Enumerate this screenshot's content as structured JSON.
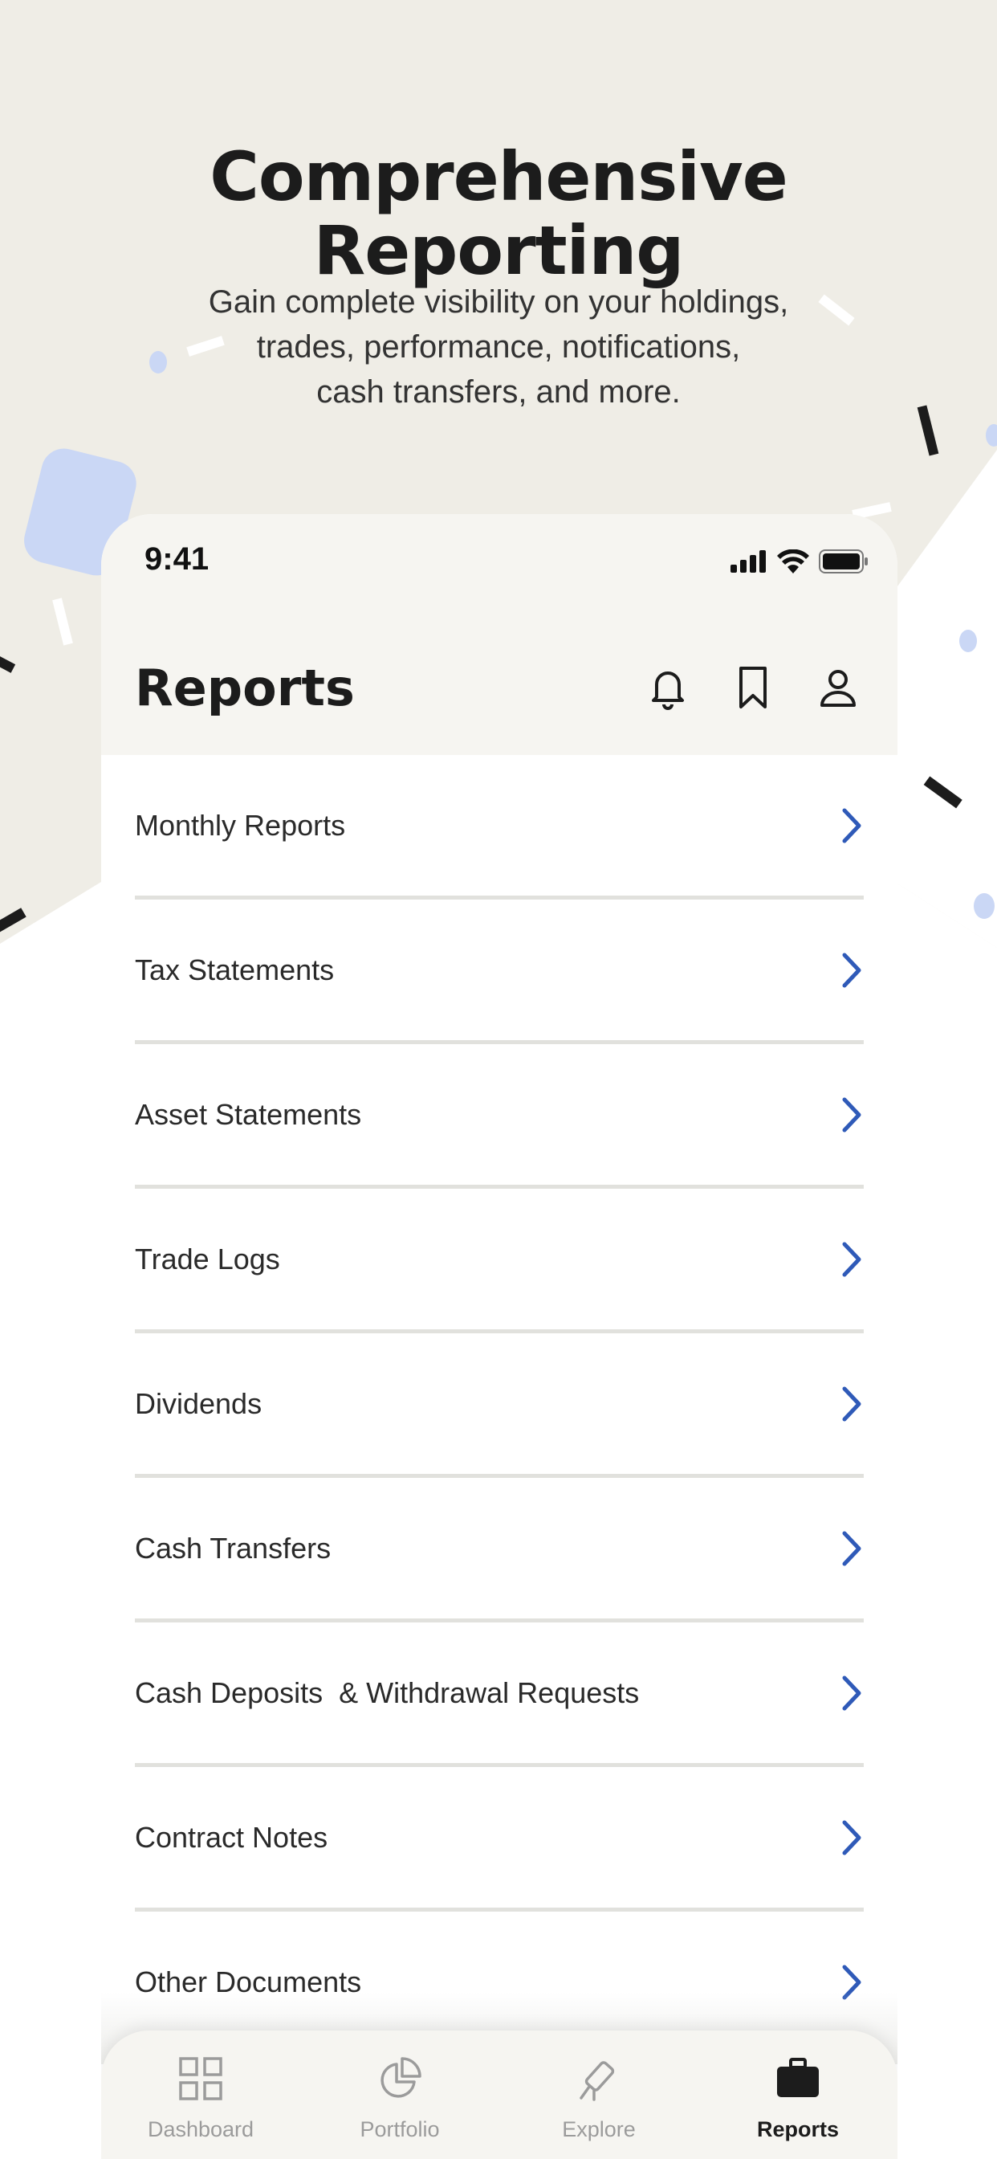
{
  "hero": {
    "title_line1": "Comprehensive",
    "title_line2": "Reporting",
    "subtitle_line1": "Gain complete visibility on your holdings,",
    "subtitle_line2": "trades, performance, notifications,",
    "subtitle_line3": "cash transfers, and more."
  },
  "status_bar": {
    "time": "9:41"
  },
  "header": {
    "title": "Reports",
    "icons": [
      "bell-icon",
      "bookmark-icon",
      "profile-icon"
    ]
  },
  "reports": [
    {
      "label": "Monthly Reports"
    },
    {
      "label": "Tax Statements"
    },
    {
      "label": "Asset Statements"
    },
    {
      "label": "Trade Logs"
    },
    {
      "label": "Dividends"
    },
    {
      "label": "Cash Transfers"
    },
    {
      "label": "Cash Deposits  & Withdrawal Requests"
    },
    {
      "label": "Contract Notes"
    },
    {
      "label": "Other Documents"
    }
  ],
  "tabs": [
    {
      "label": "Dashboard",
      "icon": "grid-icon",
      "active": false
    },
    {
      "label": "Portfolio",
      "icon": "pie-chart-icon",
      "active": false
    },
    {
      "label": "Explore",
      "icon": "telescope-icon",
      "active": false
    },
    {
      "label": "Reports",
      "icon": "briefcase-icon",
      "active": true
    }
  ],
  "colors": {
    "background": "#efede6",
    "accent": "#2f5ab8",
    "decor_blue": "#cad7f5"
  }
}
